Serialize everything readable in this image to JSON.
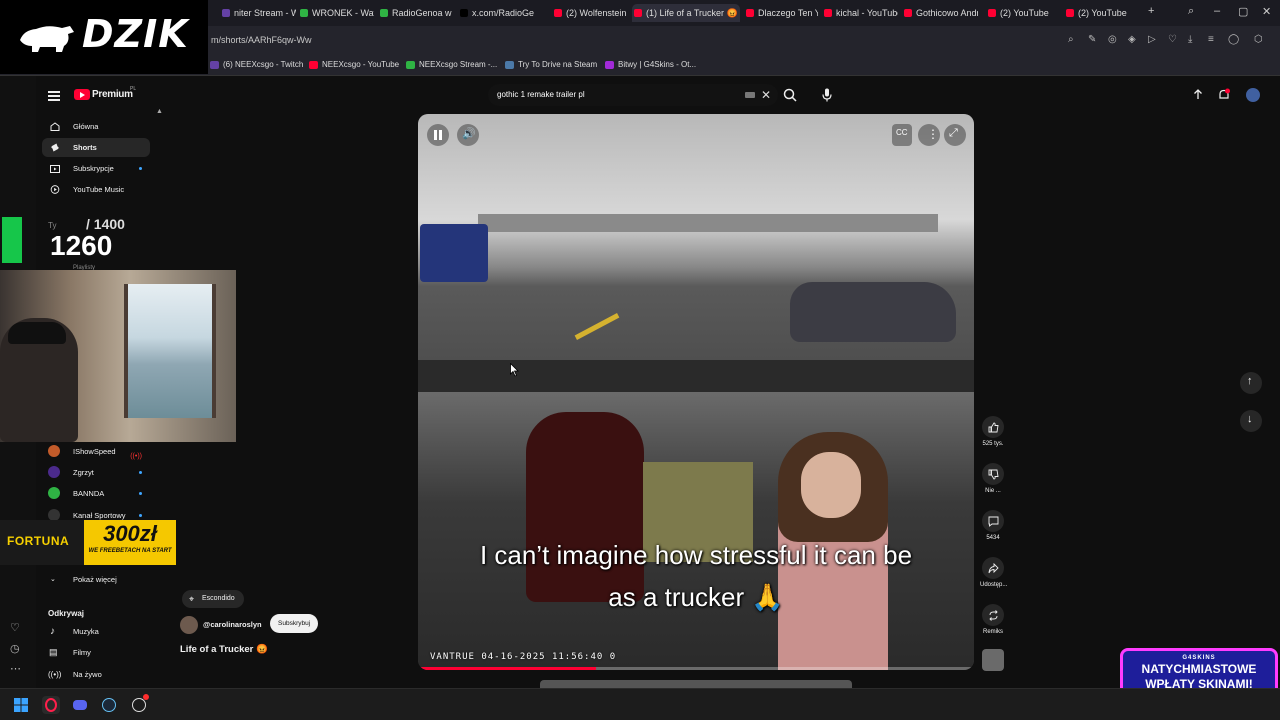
{
  "browser": {
    "tabs": [
      {
        "title": "niter Stream - W",
        "color": "#6441a5"
      },
      {
        "title": "WRONEK - Watc",
        "color": "#2fb344"
      },
      {
        "title": "RadioGenoa w s",
        "color": "#2fb344"
      },
      {
        "title": "x.com/RadioGen",
        "color": "#000000"
      },
      {
        "title": "(2) Wolfenstein",
        "color": "#ff0033"
      },
      {
        "title": "(1) Life of a Trucker 😡",
        "color": "#ff0033"
      },
      {
        "title": "Dlaczego Ten Yo",
        "color": "#ff0033"
      },
      {
        "title": "kichal - YouTube",
        "color": "#ff0033"
      },
      {
        "title": "Gothicowo Andr",
        "color": "#ff0033"
      },
      {
        "title": "(2) YouTube",
        "color": "#ff0033"
      },
      {
        "title": "(2) YouTube",
        "color": "#ff0033"
      }
    ],
    "new_tab": "+",
    "url": "m/shorts/AARhF6qw-Ww",
    "bookmarks": [
      {
        "label": "(6) NEEXcsgo - Twitch",
        "color": "#6441a5"
      },
      {
        "label": "NEEXcsgo - YouTube",
        "color": "#ff0033"
      },
      {
        "label": "NEEXcsgo Stream -...",
        "color": "#2fb344"
      },
      {
        "label": "Try To Drive na Steam",
        "color": "#4b79a8"
      },
      {
        "label": "Bitwy | G4Skins - Ot...",
        "color": "#a22ad8"
      }
    ]
  },
  "overlay": {
    "logo_text": "DZIK",
    "counter_you": "Ty",
    "counter_goal": "/ 1400",
    "counter_value": "1260",
    "counter_below": "Playlisty",
    "fortuna_brand": "FORTUNA",
    "fortuna_amount": "300zł",
    "fortuna_sub": "WE FREEBETACH NA START",
    "g4skins_brand": "G4SKINS",
    "g4skins_line1": "NATYCHMIASTOWE",
    "g4skins_line2": "WPŁATY SKINAMI!"
  },
  "youtube": {
    "logo": "Premium",
    "logo_region": "PL",
    "nav": [
      {
        "label": "Główna",
        "icon": "home-icon"
      },
      {
        "label": "Shorts",
        "icon": "shorts-icon",
        "active": true
      },
      {
        "label": "Subskrypcje",
        "icon": "subscriptions-icon",
        "dot": true
      },
      {
        "label": "YouTube Music",
        "icon": "music-icon"
      }
    ],
    "subscriptions": [
      {
        "label": "IShowSpeed",
        "color": "#c25b2a",
        "live": true
      },
      {
        "label": "Zgrzyt",
        "color": "#4b2a8c",
        "dot": true
      },
      {
        "label": "BANNDA",
        "color": "#2fb344",
        "dot": true
      },
      {
        "label": "Kanał Sportowy",
        "color": "#333333",
        "dot": true
      }
    ],
    "show_more": "Pokaż więcej",
    "explore_title": "Odkrywaj",
    "explore": [
      {
        "label": "Muzyka",
        "icon": "music-note-icon"
      },
      {
        "label": "Filmy",
        "icon": "film-icon"
      },
      {
        "label": "Na żywo",
        "icon": "live-icon"
      }
    ],
    "search": {
      "value": "gothic 1 remake trailer pl"
    },
    "video": {
      "caption_line1": "I can’t imagine how stressful it can be",
      "caption_line2": "as a trucker 🙏",
      "dashcam_stamp": "VANTRUE  04-16-2025  11:56:40  0",
      "progress": 0.32
    },
    "actions": {
      "likes": "525 tys.",
      "dislike": "Nie ...",
      "comments": "5434",
      "share": "Udostęp...",
      "remix": "Remiks"
    },
    "location": "Escondido",
    "channel": "@carolinaroslyn",
    "subscribe": "Subskrybuj",
    "title": "Life of a Trucker 😡"
  }
}
